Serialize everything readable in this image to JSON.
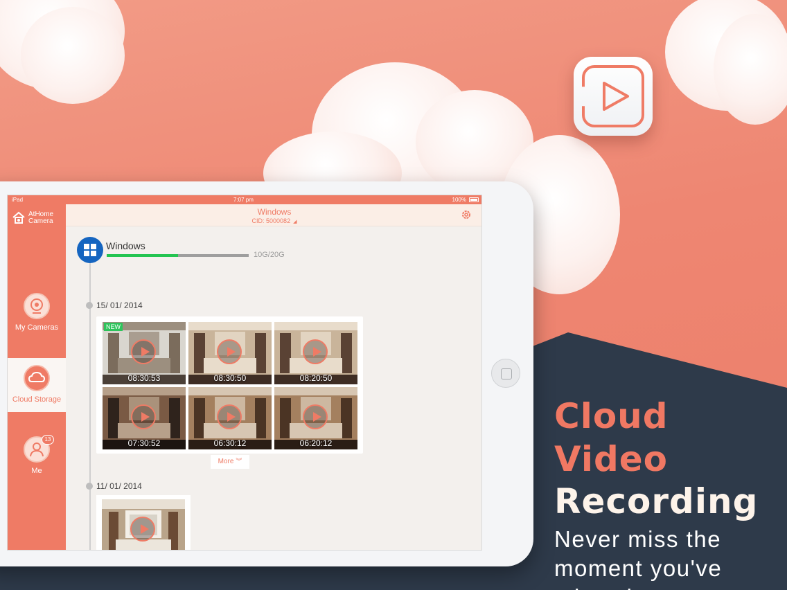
{
  "tagline": {
    "line1": "Cloud Video",
    "line2": "Recording",
    "subtitle": "Never miss the moment you've missed"
  },
  "status_bar": {
    "carrier": "iPad",
    "time": "7:07 pm",
    "battery": "100%"
  },
  "sidebar": {
    "brand_line1": "AtHome",
    "brand_line2": "Camera",
    "items": [
      {
        "label": "My Cameras",
        "icon": "camera-icon"
      },
      {
        "label": "Cloud Storage",
        "icon": "cloud-icon",
        "active": true
      },
      {
        "label": "Me",
        "icon": "person-icon",
        "badge": "13"
      }
    ]
  },
  "header": {
    "title": "Windows",
    "cid": "CID: 5000082"
  },
  "device": {
    "name": "Windows",
    "storage_used_fraction": 0.5,
    "storage_text": "10G/20G"
  },
  "groups": [
    {
      "date": "15/ 01/ 2014",
      "recordings": [
        {
          "time": "08:30:53",
          "new_label": "NEW"
        },
        {
          "time": "08:30:50"
        },
        {
          "time": "08:20:50"
        },
        {
          "time": "07:30:52"
        },
        {
          "time": "06:30:12"
        },
        {
          "time": "06:20:12"
        }
      ],
      "more_label": "More"
    },
    {
      "date": "11/ 01/ 2014",
      "recordings": [
        {
          "time": ""
        }
      ]
    }
  ],
  "colors": {
    "accent": "#ef7b65",
    "dark_band": "#2e3a4a",
    "progress": "#23c451",
    "windows_blue": "#1565c0"
  }
}
